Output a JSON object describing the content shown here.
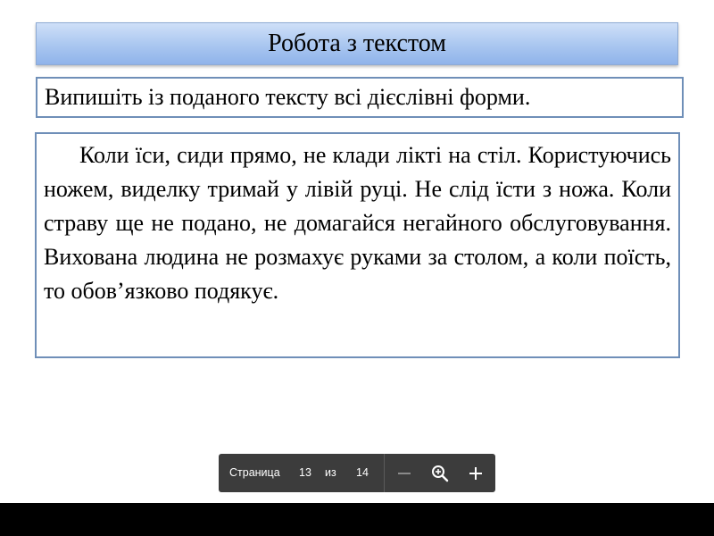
{
  "slide": {
    "title": "Робота з текстом",
    "task": "Випишіть із поданого тексту всі дієслівні форми.",
    "passage": "Коли їси, сиди прямо, не клади лікті на стіл. Користуючись ножем, виделку тримай у лівій руці. Не слід їсти з ножа. Коли страву ще не подано, не домагайся негайного обслуговування. Вихована людина не розмахує руками за столом, а коли поїсть, то обов’язково подякує."
  },
  "viewer_toolbar": {
    "page_label": "Страница",
    "current_page": "13",
    "separator": "из",
    "total_pages": "14",
    "icons": {
      "zoom_out": "minus-icon",
      "zoom": "magnifier-icon",
      "zoom_in": "plus-icon"
    }
  },
  "colors": {
    "title_gradient_top": "#cfe0f8",
    "title_gradient_bottom": "#8fb3ea",
    "box_border": "#6f8fb8",
    "toolbar_bg": "#3c3c3c"
  }
}
